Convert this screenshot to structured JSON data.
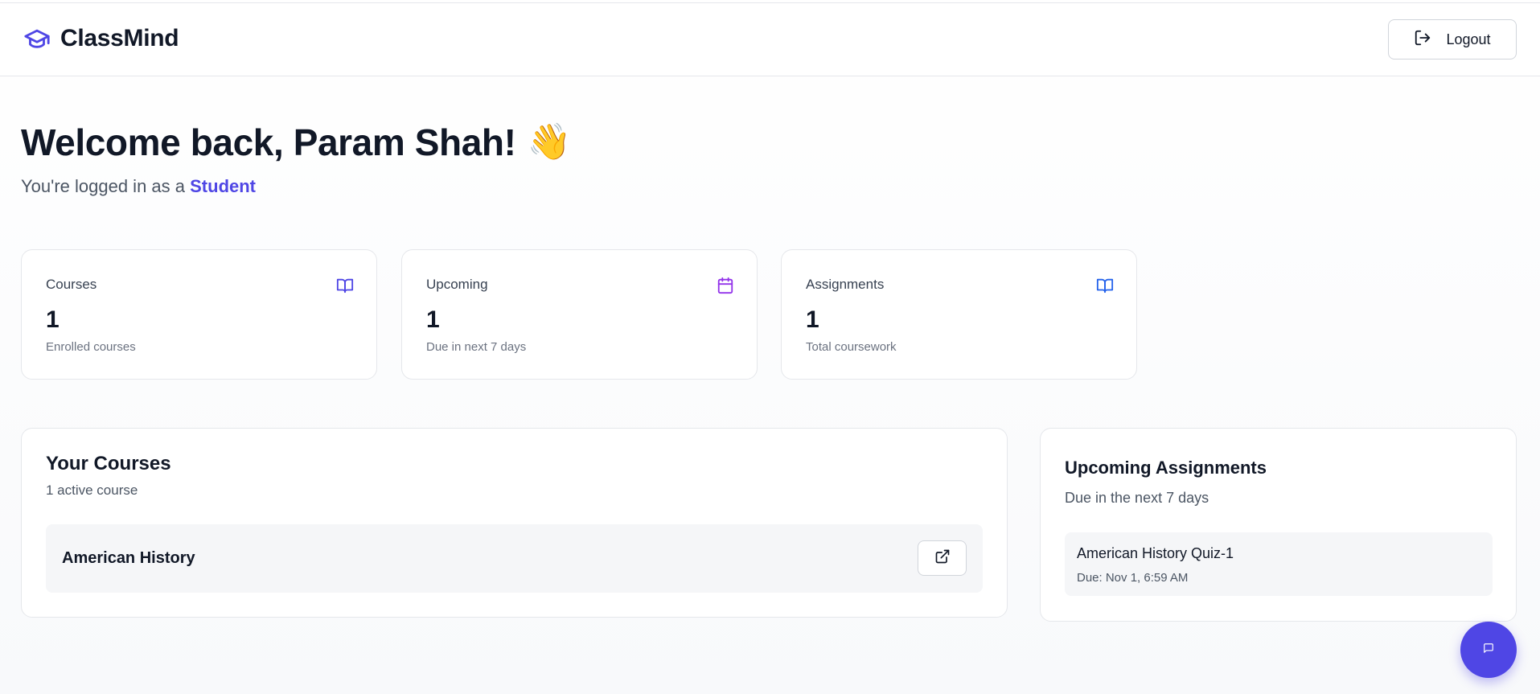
{
  "app": {
    "name": "ClassMind",
    "logo_icon": "graduation-cap-icon",
    "accent": "#4f46e5"
  },
  "header": {
    "logout_label": "Logout",
    "logout_icon": "logout-icon"
  },
  "welcome": {
    "heading": "Welcome back, Param Shah!",
    "emoji": "👋",
    "subtitle_prefix": "You're logged in as a",
    "role": "Student"
  },
  "stats": [
    {
      "title": "Courses",
      "value": "1",
      "caption": "Enrolled courses",
      "icon": "book-open-icon",
      "icon_color": "#4f46e5"
    },
    {
      "title": "Upcoming",
      "value": "1",
      "caption": "Due in next 7 days",
      "icon": "calendar-icon",
      "icon_color": "#9333ea"
    },
    {
      "title": "Assignments",
      "value": "1",
      "caption": "Total coursework",
      "icon": "book-open-icon",
      "icon_color": "#2563eb"
    }
  ],
  "courses": {
    "title": "Your Courses",
    "subtitle": "1 active course",
    "items": [
      {
        "name": "American History",
        "action_icon": "external-link-icon"
      }
    ]
  },
  "assignments": {
    "title": "Upcoming Assignments",
    "subtitle": "Due in the next 7 days",
    "items": [
      {
        "name": "American History Quiz-1",
        "due": "Due: Nov 1, 6:59 AM"
      }
    ]
  },
  "chat": {
    "icon": "chat-icon"
  }
}
